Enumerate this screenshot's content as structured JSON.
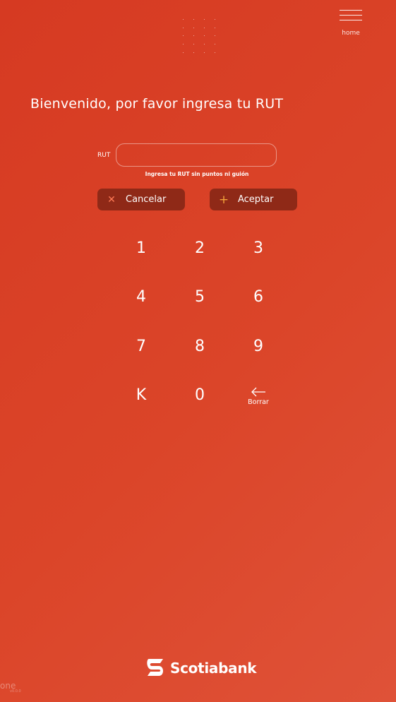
{
  "header": {
    "home_label": "home"
  },
  "main": {
    "title": "Bienvenido, por favor ingresa tu RUT",
    "rut_label": "RUT",
    "rut_value": "",
    "rut_placeholder": "",
    "hint": "Ingresa tu RUT sin puntos ni guión"
  },
  "actions": {
    "cancel_label": "Cancelar",
    "cancel_icon": "close-icon",
    "accept_label": "Aceptar",
    "accept_icon": "plus-icon"
  },
  "keypad": {
    "keys": [
      "1",
      "2",
      "3",
      "4",
      "5",
      "6",
      "7",
      "8",
      "9",
      "K",
      "0"
    ],
    "backspace_label": "Borrar",
    "backspace_icon": "arrow-left-icon"
  },
  "footer": {
    "brand": "Scotiabank",
    "app_badge": "one",
    "app_version": "v0.0.0"
  },
  "colors": {
    "background": "#d8402a",
    "button": "#8f2917",
    "cancel_icon": "#ff7a56",
    "accept_icon": "#f2a33a"
  }
}
